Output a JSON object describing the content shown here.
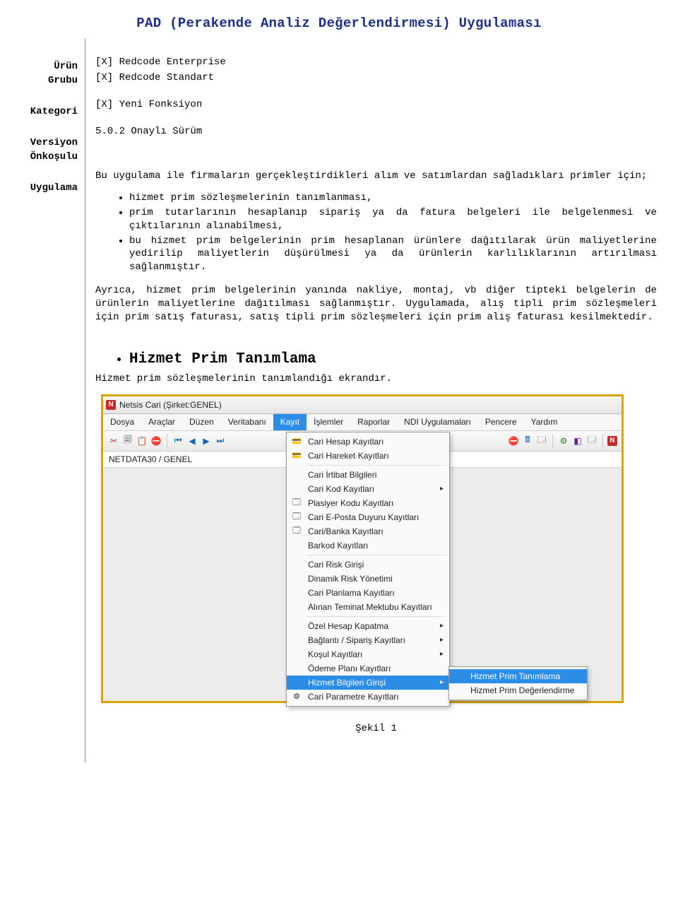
{
  "doc": {
    "title": "PAD (Perakende Analiz Değerlendirmesi) Uygulaması",
    "labels": {
      "product_group": "Ürün",
      "product_group2": "Grubu",
      "category": "Kategori",
      "version": "Versiyon",
      "prereq": "Önkoşulu",
      "application": "Uygulama"
    },
    "product_group_lines": {
      "l1": "[X] Redcode Enterprise",
      "l2": "[X] Redcode Standart"
    },
    "category_value": "[X] Yeni Fonksiyon",
    "version_value": "5.0.2 Onaylı Sürüm",
    "app_paragraph1": "Bu uygulama ile firmaların gerçekleştirdikleri alım ve satımlardan sağladıkları primler için;",
    "app_bullets": {
      "b1": "hizmet prim sözleşmelerinin tanımlanması,",
      "b2": "prim tutarlarının hesaplanıp sipariş ya da fatura belgeleri ile belgelenmesi ve çıktılarının alınabilmesi,",
      "b3": "bu hizmet prim belgelerinin prim hesaplanan ürünlere dağıtılarak ürün maliyetlerine yedirilip maliyetlerin düşürülmesi ya da ürünlerin karlılıklarının artırılması sağlanmıştır."
    },
    "app_paragraph2": "Ayrıca, hizmet prim belgelerinin yanında nakliye, montaj, vb diğer tipteki belgelerin de ürünlerin maliyetlerine dağıtılması sağlanmıştır. Uygulamada, alış tipli prim sözleşmeleri için prim satış faturası, satış tipli prim sözleşmeleri için prim alış faturası kesilmektedir.",
    "heading_bullet": "Hizmet Prim Tanımlama",
    "heading_sub": "Hizmet prim sözleşmelerinin tanımlandığı ekrandır.",
    "figure_caption": "Şekil 1"
  },
  "app": {
    "titlebar": {
      "icon_letter": "N",
      "title": "Netsis Cari (Şirket:GENEL)"
    },
    "menubar": {
      "m1": "Dosya",
      "m2": "Araçlar",
      "m3": "Düzen",
      "m4": "Veritabanı",
      "m5": "Kayıt",
      "m6": "İşlemler",
      "m7": "Raporlar",
      "m8": "NDI Uygulamaları",
      "m9": "Pencere",
      "m10": "Yardım"
    },
    "status_row": "NETDATA30 / GENEL",
    "menu": {
      "i1": "Cari Hesap Kayıtları",
      "i2": "Cari Hareket Kayıtları",
      "i3": "Cari İrtibat Bilgileri",
      "i4": "Cari Kod Kayıtları",
      "i5": "Plasiyer Kodu Kayıtları",
      "i6": "Cari E-Posta Duyuru Kayıtları",
      "i7": "Cari/Banka Kayıtları",
      "i8": "Barkod Kayıtları",
      "i9": "Cari Risk Girişi",
      "i10": "Dinamik Risk Yönetimi",
      "i11": "Cari Planlama Kayıtları",
      "i12": "Alınan Teminat Mektubu Kayıtları",
      "i13": "Özel Hesap Kapatma",
      "i14": "Bağlantı / Sipariş Kayıtları",
      "i15": "Koşul Kayıtları",
      "i16": "Ödeme Planı Kayıtları",
      "i17": "Hizmet Bilgileri Girişi",
      "i18": "Cari Parametre Kayıtları"
    },
    "submenu": {
      "s1": "Hizmet Prim Tanımlama",
      "s2": "Hizmet Prim Değerlendirme"
    }
  }
}
